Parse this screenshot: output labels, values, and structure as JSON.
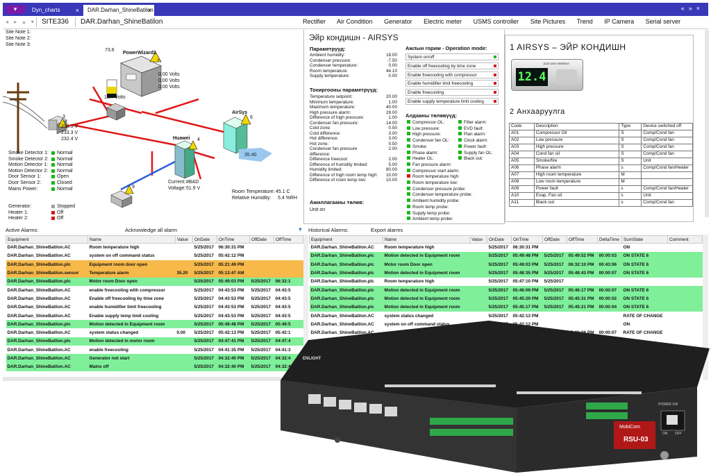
{
  "tabs": [
    "Dyn_charts",
    "DAR.Darhan_ShineBatilon"
  ],
  "nav": {
    "site": "SITE336",
    "device": "DAR.Darhan_ShineBatilon",
    "links": [
      "Rectifier",
      "Air Condition",
      "Generator",
      "Electric meter",
      "USMS controller",
      "Site Pictures",
      "Trend",
      "IP Camera",
      "Serial server"
    ]
  },
  "site_notes": [
    "Site Note 1:",
    "Site Note 2:",
    "Site Note 3:"
  ],
  "diagram": {
    "fuel_level": "73.6",
    "genset_name": "PowerWizard2",
    "genset_num": "7",
    "genset_volts": [
      "0.00 Volts",
      "0.00 Volts",
      "0.00 Volts"
    ],
    "battery_volts": "13.7 Volts",
    "mains_v": [
      "232.3 V",
      "233.3 V",
      "232.4 V"
    ],
    "mains_num": "3",
    "huawei_name": "Huawei",
    "huawei_num": "4",
    "current_lbl": "Current:",
    "current_val": "#BAD",
    "voltage_lbl": "Voltage:",
    "voltage_val": "51.9 V",
    "airsys_name": "AirSys",
    "airsys_num": "6",
    "airsys_temp": "35.40",
    "usms_num": "9",
    "room_temp_lbl": "Room Temperature:",
    "room_temp": "45.1 C",
    "humidity_lbl": "Relative Humidity:",
    "humidity": "5.4 %RH",
    "sensors": [
      {
        "name": "Smoke Detector 1:",
        "state": "Normal",
        "color": "green"
      },
      {
        "name": "Smoke Detector 2:",
        "state": "Normal",
        "color": "green"
      },
      {
        "name": "Motion Detector 1:",
        "state": "Normal",
        "color": "green"
      },
      {
        "name": "Motion Detector 2:",
        "state": "Normal",
        "color": "green"
      },
      {
        "name": "Door Sensor 1:",
        "state": "Open",
        "color": "green"
      },
      {
        "name": "Door Sensor 2:",
        "state": "Closed",
        "color": "green"
      },
      {
        "name": "Mains Power:",
        "state": "Normal",
        "color": "green"
      }
    ],
    "gen_status": [
      {
        "name": "Generator:",
        "state": "Stopped",
        "color": "grey"
      },
      {
        "name": "Heater 1:",
        "state": "Off",
        "color": "red"
      },
      {
        "name": "Heater 2:",
        "state": "Off",
        "color": "red"
      }
    ]
  },
  "aircon": {
    "title": "Эйр кондишн - AIRSYS",
    "params_title": "Параметрууд:",
    "params": [
      [
        "Ambient humidity:",
        "18.00"
      ],
      [
        "Condenser pressure:",
        "-7.50"
      ],
      [
        "Condenser temperature:",
        "0.00"
      ],
      [
        "Room temperature:",
        "44.10"
      ],
      [
        "Supply temperature:",
        "0.00"
      ]
    ],
    "cfg_title": "Тохиргооны параметрүүд:",
    "cfg": [
      [
        "Temperature setpoint:",
        "20.00"
      ],
      [
        "Minimum temperature:",
        "1.00"
      ],
      [
        "Maximum temperature:",
        "40.00"
      ],
      [
        "High pressure alarm:",
        "29.00"
      ],
      [
        "Difference of high pressure:",
        "1.00"
      ],
      [
        "Condenser fan pressure:",
        "14.00"
      ],
      [
        "Cold zone:",
        "0.50"
      ],
      [
        "Cold difference:",
        "3.00"
      ],
      [
        "Hot difference:",
        "3.00"
      ],
      [
        "Hot zone:",
        "0.50"
      ],
      [
        "Condenser fan pressure difference:",
        "2.00"
      ],
      [
        "Difference freecool:",
        "2.00"
      ],
      [
        "Difference of humidity limited:",
        "5.00"
      ],
      [
        "Humidity limited:",
        "80.00"
      ],
      [
        "Difference of high room temp high:",
        "10.00"
      ],
      [
        "Difference of room temp low:",
        "10.00"
      ]
    ],
    "run_title": "Ажиллагааны төлөв:",
    "run_state": "Unit on",
    "op_title": "Ажлын горим - Operation mode:",
    "op_modes": [
      {
        "label": "System on/off",
        "color": "green"
      },
      {
        "label": "Enable off freecooling by time zone",
        "color": "red"
      },
      {
        "label": "Enable freecooling with compressor",
        "color": "red"
      },
      {
        "label": "Enable humidifier limit freecooling",
        "color": "red"
      },
      {
        "label": "Enable freecooling",
        "color": "red"
      },
      {
        "label": "Enable supply temperature limit cooling",
        "color": "red"
      }
    ],
    "alarm_title": "Алдааны төлөвүүд:",
    "alarms_col1": [
      {
        "label": "Compressor OL:",
        "color": "green"
      },
      {
        "label": "Low pressure:",
        "color": "green"
      },
      {
        "label": "High pressure:",
        "color": "green"
      },
      {
        "label": "Condenser fan OL:",
        "color": "green"
      },
      {
        "label": "Smoke:",
        "color": "green"
      },
      {
        "label": "Phase alarm:",
        "color": "green"
      },
      {
        "label": "Heater OL:",
        "color": "green"
      },
      {
        "label": "Fan pressure alarm:",
        "color": "green"
      },
      {
        "label": "Compressor start alarm:",
        "color": "green"
      },
      {
        "label": "Room temperature high:",
        "color": "red"
      },
      {
        "label": "Room temperature low:",
        "color": "green"
      },
      {
        "label": "Condenser pressure probe:",
        "color": "green"
      },
      {
        "label": "Condenser temperature probe:",
        "color": "green"
      },
      {
        "label": "Ambient humidity probe:",
        "color": "green"
      },
      {
        "label": "Room temp probe:",
        "color": "green"
      },
      {
        "label": "Supply temp probe:",
        "color": "green"
      },
      {
        "label": "Ambient temp probe:",
        "color": "green"
      }
    ],
    "alarms_col2": [
      {
        "label": "Filter alarm:",
        "color": "green"
      },
      {
        "label": "EVD fault:",
        "color": "green"
      },
      {
        "label": "Plan alarm:",
        "color": "green"
      },
      {
        "label": "Clock alarm:",
        "color": "green"
      },
      {
        "label": "Power fault:",
        "color": "green"
      },
      {
        "label": "Supply fan OL:",
        "color": "green"
      },
      {
        "label": "Black out:",
        "color": "green"
      }
    ]
  },
  "airsys_info": {
    "title1": "1  AIRSYS – ЭЙР КОНДИШН",
    "display": "12.4",
    "brand": "pLD user interface",
    "title2": "2  Анхааруулга",
    "codes_head": [
      "Code",
      "Description",
      "Type",
      "Device switched off"
    ],
    "codes": [
      [
        "A01",
        "Compressor Oil",
        "S",
        "Comp/Cond fan"
      ],
      [
        "A02",
        "Low pressure",
        "S",
        "Comp/Cond fan"
      ],
      [
        "A03",
        "High pressure",
        "S",
        "Comp/Cond fan"
      ],
      [
        "A04",
        "Cond fan oil",
        "S",
        "Comp/Cond fan"
      ],
      [
        "A05",
        "Smoke/fire",
        "S",
        "Unit"
      ],
      [
        "A06",
        "Phase alarm",
        "s",
        "Comp/Cond fan/Heater"
      ],
      [
        "A07",
        "High room temperature",
        "M",
        ""
      ],
      [
        "A08",
        "Low room temperature",
        "M",
        ""
      ],
      [
        "A09",
        "Power fault",
        "s",
        "Comp/Cond fan/Heater"
      ],
      [
        "A10",
        "Evap. Fan oil",
        "s",
        "Unit"
      ],
      [
        "A11",
        "Black out",
        "s",
        "Comp/Cond fan"
      ]
    ]
  },
  "active_alarms": {
    "title": "Active Alarms:",
    "ack": "Acknowledge all alarm",
    "headers": [
      "Equipment",
      "Name",
      "Value",
      "OnDate",
      "OnTime",
      "OffDate",
      "OffTime"
    ],
    "rows": [
      {
        "c": "",
        "v": [
          "DAR.Darhan_ShineBatilon.AC",
          "Room temperature high",
          "",
          "5/25/2017",
          "06:30:31 PM",
          "",
          ""
        ]
      },
      {
        "c": "",
        "v": [
          "DAR.Darhan_ShineBatilon.AC",
          "system on off command status",
          "",
          "5/25/2017",
          "05:42:12 PM",
          "",
          ""
        ]
      },
      {
        "c": "o",
        "v": [
          "DAR.Darhan_ShineBatilon.plc",
          "Equipment room door open",
          "",
          "5/25/2017",
          "05:21:49 PM",
          "",
          ""
        ]
      },
      {
        "c": "o",
        "v": [
          "DAR.Darhan_ShineBatilon.sensor",
          "Temperature alarm",
          "35.20",
          "5/25/2017",
          "05:13:47 AM",
          "",
          ""
        ]
      },
      {
        "c": "g",
        "v": [
          "DAR.Darhan_ShineBatilon.plc",
          "Motor room Door open",
          "",
          "5/25/2017",
          "05:49:03 PM",
          "5/25/2017",
          "06:32:1"
        ]
      },
      {
        "c": "",
        "v": [
          "DAR.Darhan_ShineBatilon.AC",
          "enable freecooling with compressor",
          "",
          "5/25/2017",
          "04:43:53 PM",
          "5/25/2017",
          "04:43:5"
        ]
      },
      {
        "c": "",
        "v": [
          "DAR.Darhan_ShineBatilon.AC",
          "Enable off freecooling by time zone",
          "",
          "5/25/2017",
          "04:43:53 PM",
          "5/25/2017",
          "04:43:5"
        ]
      },
      {
        "c": "",
        "v": [
          "DAR.Darhan_ShineBatilon.AC",
          "enable humidifier limit freecooling",
          "",
          "5/25/2017",
          "04:43:53 PM",
          "5/25/2017",
          "04:43:5"
        ]
      },
      {
        "c": "",
        "v": [
          "DAR.Darhan_ShineBatilon.AC",
          "Enable supply temp limit cooling",
          "",
          "5/25/2017",
          "04:43:53 PM",
          "5/25/2017",
          "04:43:5"
        ]
      },
      {
        "c": "g",
        "v": [
          "DAR.Darhan_ShineBatilon.plc",
          "Motion detected in Equipment room",
          "",
          "5/25/2017",
          "05:49:48 PM",
          "5/25/2017",
          "05:49:5"
        ]
      },
      {
        "c": "",
        "v": [
          "DAR.Darhan_ShineBatilon.AC",
          "system status changed",
          "0.00",
          "5/25/2017",
          "05:42:13 PM",
          "5/25/2017",
          "05:42:1"
        ]
      },
      {
        "c": "g",
        "v": [
          "DAR.Darhan_ShineBatilon.plc",
          "Motion detected in motor room",
          "",
          "5/25/2017",
          "04:47:41 PM",
          "5/25/2017",
          "04:47:4"
        ]
      },
      {
        "c": "",
        "v": [
          "DAR.Darhan_ShineBatilon.AC",
          "enable freecooling",
          "",
          "5/25/2017",
          "04:41:35 PM",
          "5/25/2017",
          "04:41:3"
        ]
      },
      {
        "c": "g",
        "v": [
          "DAR.Darhan_ShineBatilon.AC",
          "Generator not start",
          "",
          "5/25/2017",
          "04:32:40 PM",
          "5/25/2017",
          "04:32:4"
        ]
      },
      {
        "c": "g",
        "v": [
          "DAR.Darhan_ShineBatilon.AC",
          "Mains off",
          "",
          "5/25/2017",
          "04:32:40 PM",
          "5/25/2017",
          "04:32:4"
        ]
      }
    ]
  },
  "hist_alarms": {
    "title": "Historical Alarms:",
    "export": "Export alarms",
    "headers": [
      "Equipment",
      "Name",
      "Value",
      "OnDate",
      "OnTime",
      "OffDate",
      "OffTime",
      "DeltaTime",
      "SumState",
      "Comment"
    ],
    "rows": [
      {
        "c": "",
        "v": [
          "DAR.Darhan_ShineBatilon.AC",
          "Room temperature high",
          "",
          "5/25/2017",
          "06:30:31 PM",
          "",
          "",
          "",
          "ON",
          ""
        ]
      },
      {
        "c": "g",
        "v": [
          "DAR.Darhan_ShineBatilon.plc",
          "Motion detected in Equipment room",
          "",
          "5/25/2017",
          "05:49:48 PM",
          "5/25/2017",
          "05:49:52 PM",
          "00:00:03",
          "ON STATE 6",
          ""
        ]
      },
      {
        "c": "g",
        "v": [
          "DAR.Darhan_ShineBatilon.plc",
          "Motor room Door open",
          "",
          "5/25/2017",
          "05:49:03 PM",
          "5/25/2017",
          "06:32:10 PM",
          "00:43:06",
          "ON STATE 6",
          ""
        ]
      },
      {
        "c": "g",
        "v": [
          "DAR.Darhan_ShineBatilon.plc",
          "Motion detected in Equipment room",
          "",
          "5/25/2017",
          "05:48:35 PM",
          "5/25/2017",
          "05:48:43 PM",
          "00:00:07",
          "ON STATE 6",
          ""
        ]
      },
      {
        "c": "",
        "v": [
          "DAR.Darhan_ShineBatilon.plc",
          "Room temperature high",
          "",
          "5/25/2017",
          "05:47:10 PM",
          "5/25/2017",
          "",
          "",
          "",
          ""
        ]
      },
      {
        "c": "g",
        "v": [
          "DAR.Darhan_ShineBatilon.plc",
          "Motion detected in Equipment room",
          "",
          "5/25/2017",
          "05:46:09 PM",
          "5/25/2017",
          "05:46:17 PM",
          "00:00:07",
          "ON STATE 6",
          ""
        ]
      },
      {
        "c": "g",
        "v": [
          "DAR.Darhan_ShineBatilon.plc",
          "Motion detected in Equipment room",
          "",
          "5/25/2017",
          "05:45:29 PM",
          "5/25/2017",
          "05:45:31 PM",
          "00:00:02",
          "ON STATE 6",
          ""
        ]
      },
      {
        "c": "g",
        "v": [
          "DAR.Darhan_ShineBatilon.plc",
          "Motion detected in Equipment room",
          "",
          "5/25/2017",
          "05:45:17 PM",
          "5/25/2017",
          "05:45:21 PM",
          "00:00:04",
          "ON STATE 6",
          ""
        ]
      },
      {
        "c": "",
        "v": [
          "DAR.Darhan_ShineBatilon.AC",
          "system status changed",
          "",
          "5/25/2017",
          "05:42:13 PM",
          "",
          "",
          "",
          "RATE OF CHANGE",
          ""
        ]
      },
      {
        "c": "",
        "v": [
          "DAR.Darhan_ShineBatilon.AC",
          "system on off command status",
          "",
          "5/25/2017",
          "05:42:12 PM",
          "",
          "",
          "",
          "ON",
          ""
        ]
      },
      {
        "c": "",
        "v": [
          "DAR.Darhan_ShineBatilon.AC",
          "",
          "",
          "5/25/2017",
          "",
          "5/25/2017",
          "05:36:08 PM",
          "00:00:07",
          "RATE OF CHANGE",
          ""
        ]
      }
    ]
  },
  "device": {
    "brand": "ENLIGHT",
    "maker": "MobiCom",
    "model": "RSU-03",
    "power": "POWER SW",
    "on": "ON",
    "off": "OFF"
  }
}
